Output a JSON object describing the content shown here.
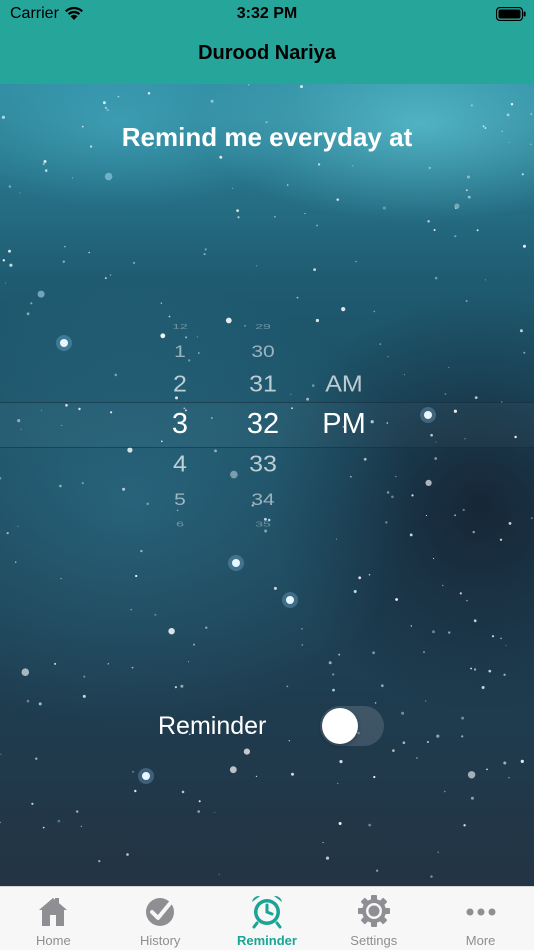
{
  "status_bar": {
    "carrier": "Carrier",
    "time": "3:32 PM"
  },
  "nav": {
    "title": "Durood Nariya"
  },
  "reminder": {
    "prompt": "Remind me everyday at",
    "picker": {
      "hours": [
        "12",
        "1",
        "2",
        "3",
        "4",
        "5",
        "6"
      ],
      "minutes": [
        "29",
        "30",
        "31",
        "32",
        "33",
        "34",
        "35"
      ],
      "periods": [
        "AM",
        "PM"
      ],
      "selected_hour": "3",
      "selected_minute": "32",
      "selected_period": "PM"
    },
    "toggle_label": "Reminder",
    "toggle_on": false
  },
  "tabbar": {
    "tabs": [
      {
        "label": "Home",
        "icon": "home-icon"
      },
      {
        "label": "History",
        "icon": "check-circle-icon"
      },
      {
        "label": "Reminder",
        "icon": "alarm-clock-icon"
      },
      {
        "label": "Settings",
        "icon": "gear-icon"
      },
      {
        "label": "More",
        "icon": "more-dots-icon"
      }
    ],
    "active_index": 2
  },
  "colors": {
    "header": "#26a59a",
    "accent": "#1aa495",
    "inactive": "#8e8e93"
  }
}
